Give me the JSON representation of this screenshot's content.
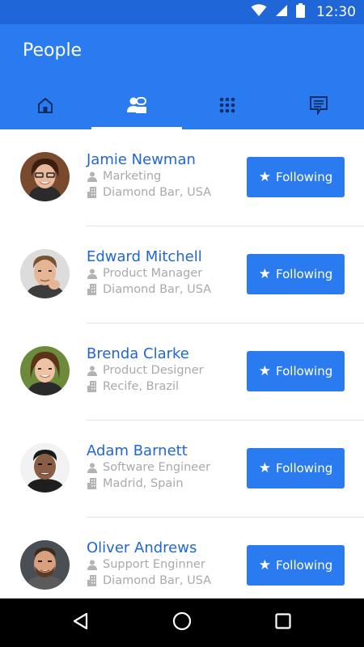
{
  "status_bar": {
    "time": "12:30",
    "icons": [
      "wifi-icon",
      "signal-icon",
      "battery-icon"
    ]
  },
  "app": {
    "title": "People",
    "accent_color": "#2a7bf0",
    "status_color": "#1f66d9"
  },
  "tabs": [
    {
      "icon": "home-icon",
      "active": false
    },
    {
      "icon": "people-icon",
      "active": true
    },
    {
      "icon": "grid-icon",
      "active": false
    },
    {
      "icon": "message-icon",
      "active": false
    }
  ],
  "people": [
    {
      "name": "Jamie Newman",
      "role": "Marketing",
      "location": "Diamond Bar, USA",
      "button": "Following"
    },
    {
      "name": "Edward Mitchell",
      "role": "Product Manager",
      "location": "Diamond Bar, USA",
      "button": "Following"
    },
    {
      "name": "Brenda Clarke",
      "role": "Product Designer",
      "location": "Recife, Brazil",
      "button": "Following"
    },
    {
      "name": "Adam Barnett",
      "role": "Software Engineer",
      "location": "Madrid, Spain",
      "button": "Following"
    },
    {
      "name": "Oliver Andrews",
      "role": "Support Enginner",
      "location": "Diamond Bar, USA",
      "button": "Following"
    }
  ],
  "nav": [
    "back-icon",
    "home-icon",
    "recents-icon"
  ]
}
